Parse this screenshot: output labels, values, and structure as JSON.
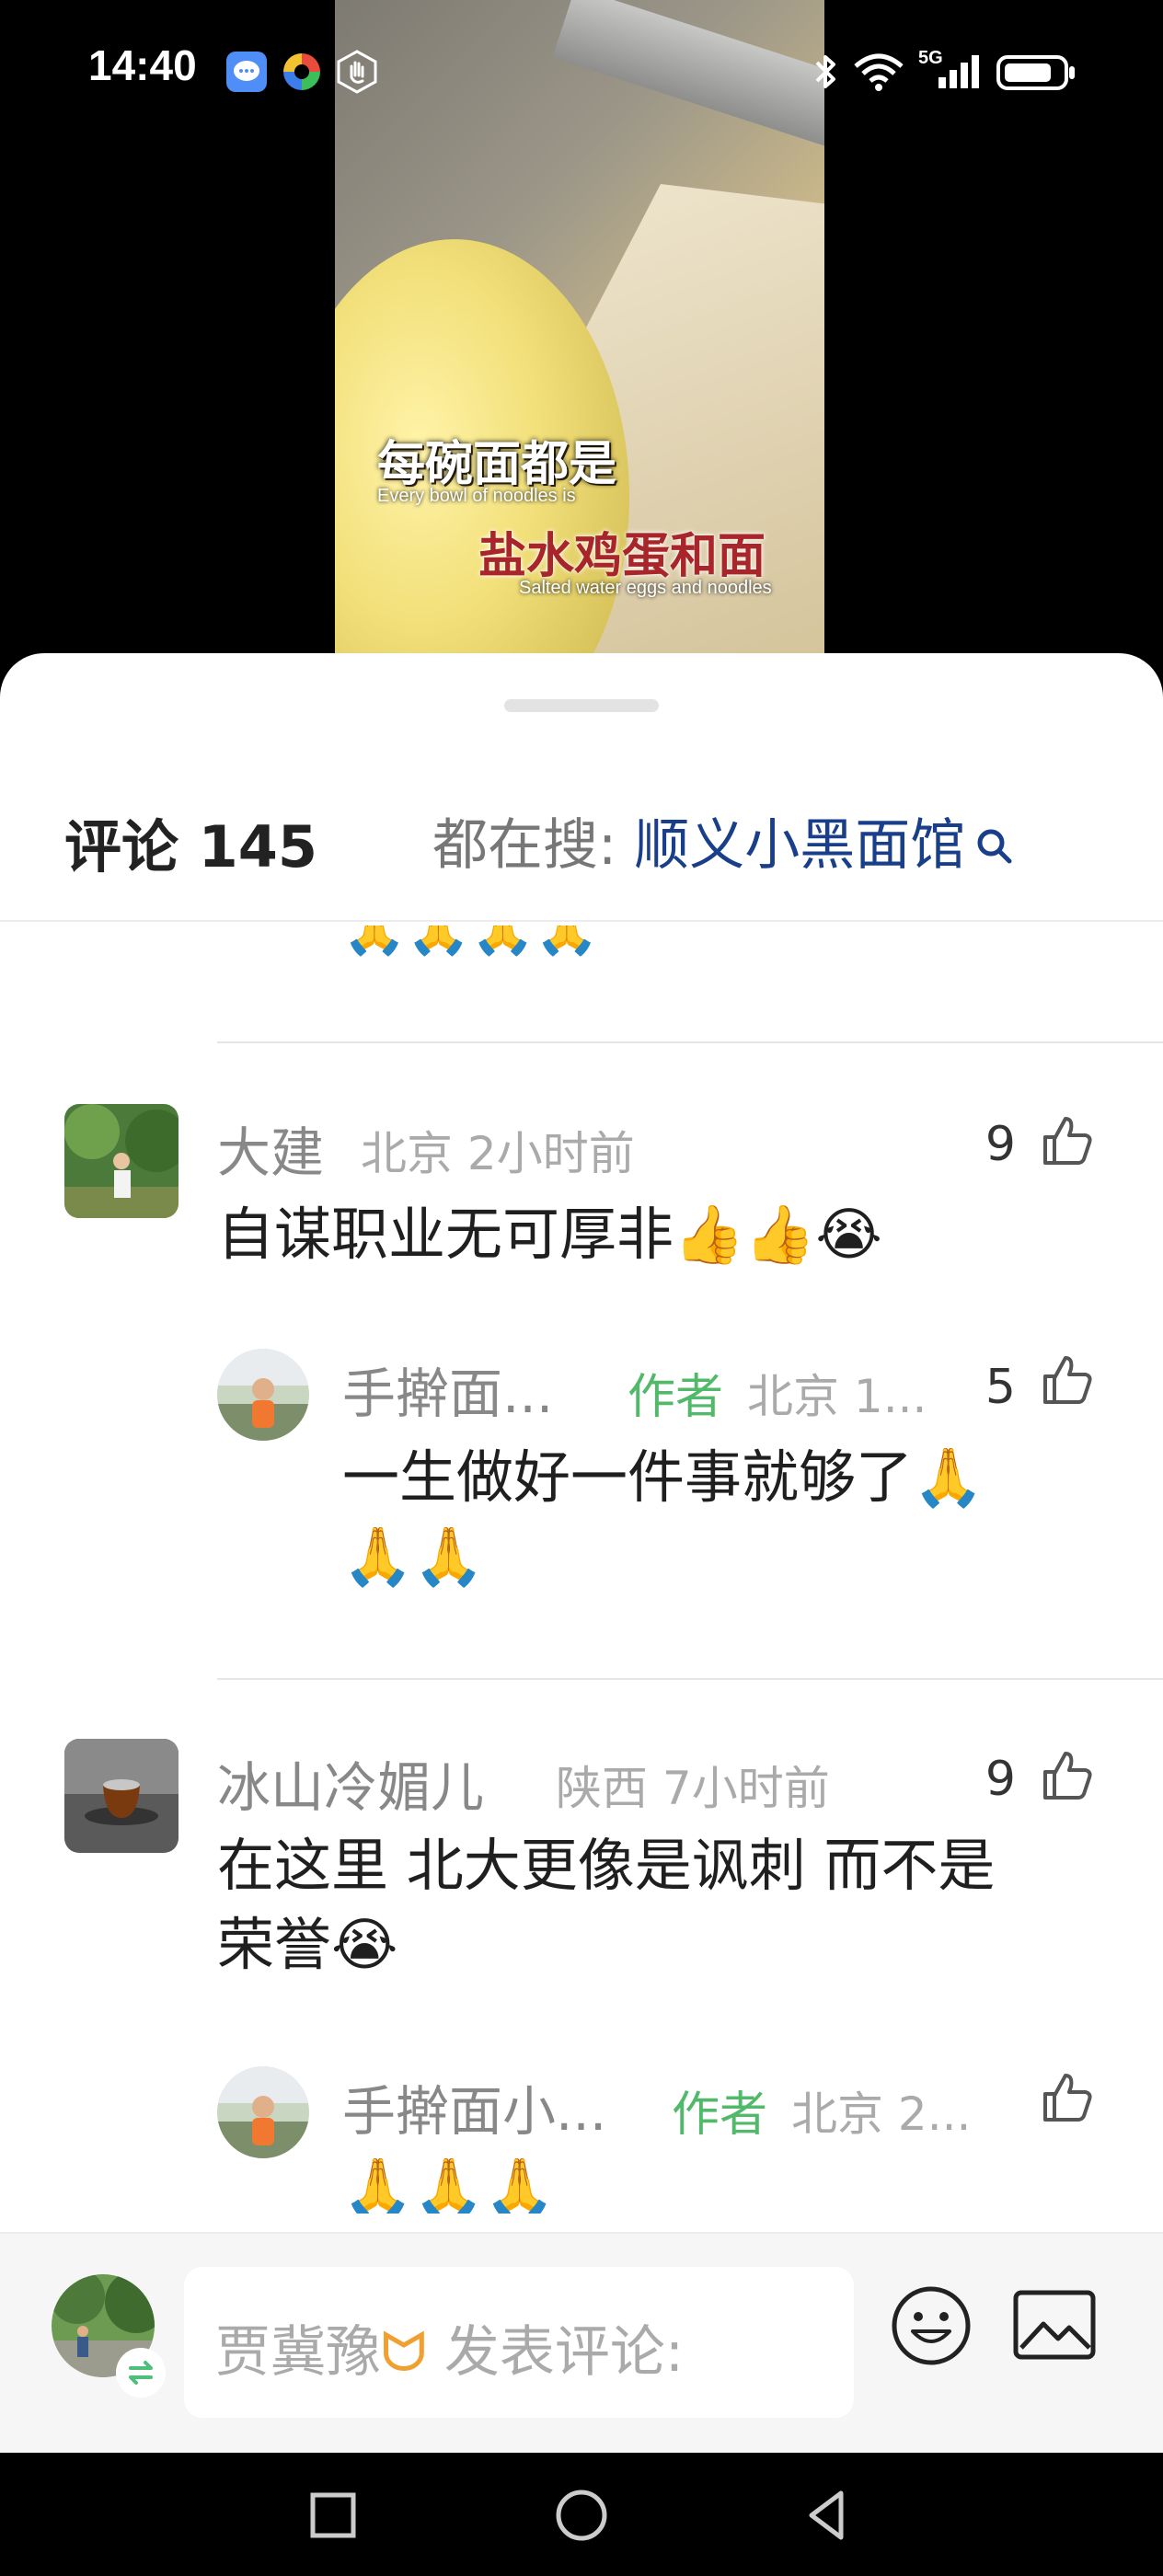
{
  "status_bar": {
    "time": "14:40",
    "network": "5G"
  },
  "video": {
    "caption_cn_1": "每碗面都是",
    "caption_en_1": "Every bowl of noodles is",
    "caption_cn_2": "盐水鸡蛋和面",
    "caption_en_2": "Salted water eggs and noodles"
  },
  "comments_header": {
    "title": "评论 145",
    "search_label": "都在搜: ",
    "search_term": "顺义小黑面馆"
  },
  "partial_top_reply": {
    "emojis": "🙏🙏🙏🙏"
  },
  "comments": [
    {
      "name": "大建",
      "location": "北京",
      "time": "2小时前",
      "likes": "9",
      "content": "自谋职业无可厚非👍👍😭",
      "reply": {
        "name": "手擀面...",
        "badge": "作者",
        "meta": "北京 1...",
        "likes": "5",
        "line1": "一生做好一件事就够了🙏",
        "line2": "🙏🙏"
      }
    },
    {
      "name": "冰山冷媚儿",
      "location": "陕西",
      "time": "7小时前",
      "likes": "9",
      "line1": "在这里 北大更像是讽刺 而不是",
      "line2": "荣誉😭",
      "reply": {
        "name": "手擀面小...",
        "badge": "作者",
        "meta": "北京 2...",
        "likes": "",
        "line1": "🙏🙏🙏"
      }
    }
  ],
  "input": {
    "username": "贾冀豫",
    "placeholder": "发表评论:",
    "deco": "ᗢ"
  },
  "colors": {
    "search_term": "#1a3f8a",
    "author_badge": "#52b86a",
    "sheet_bg": "#ffffff"
  }
}
